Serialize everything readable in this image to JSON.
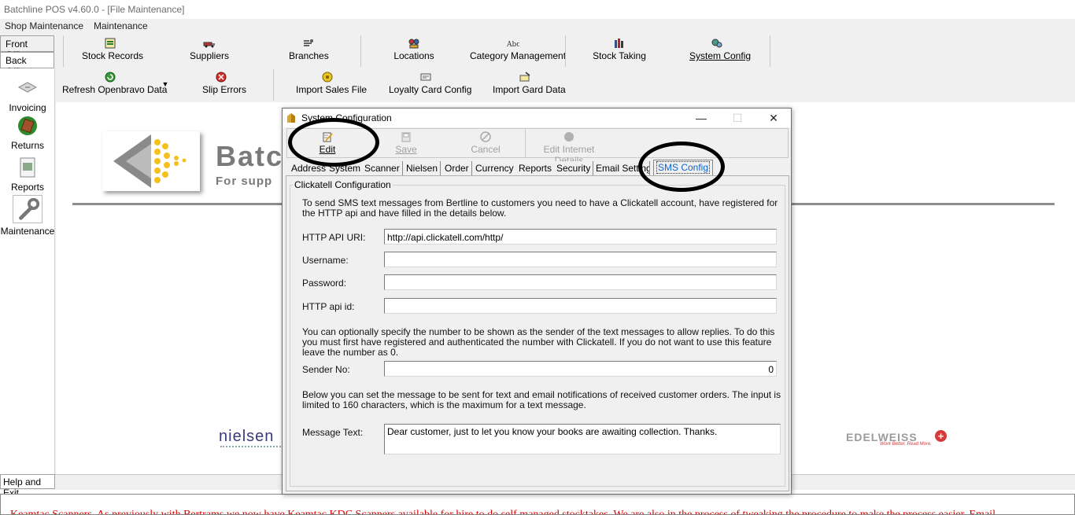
{
  "window": {
    "title": "Batchline POS v4.60.0 - [File Maintenance]"
  },
  "menu": {
    "items": [
      "Shop Maintenance",
      "Maintenance"
    ]
  },
  "office_tabs": {
    "front": "Front Office",
    "back": "Back Office"
  },
  "left_panel": {
    "items": [
      {
        "label": "Invoicing",
        "icon": "invoice-icon"
      },
      {
        "label": "Returns",
        "icon": "returns-icon"
      },
      {
        "label": "Reports",
        "icon": "reports-icon"
      },
      {
        "label": "Maintenance",
        "icon": "wrench-icon"
      }
    ]
  },
  "toolbar_row1": [
    {
      "label": "Stock Records",
      "icon": "stock-records-icon"
    },
    {
      "label": "Suppliers",
      "icon": "truck-icon"
    },
    {
      "label": "Branches",
      "icon": "branches-icon"
    },
    {
      "label": "Locations",
      "icon": "locations-icon"
    },
    {
      "label": "Category Management",
      "icon": "abc-icon"
    },
    {
      "label": "Stock Taking",
      "icon": "books-icon"
    },
    {
      "label": "System Config",
      "icon": "system-config-icon"
    }
  ],
  "toolbar_row2": [
    {
      "label": "Refresh Openbravo Data",
      "icon": "refresh-icon"
    },
    {
      "label": "Slip Errors",
      "icon": "slip-errors-icon"
    },
    {
      "label": "Import Sales File",
      "icon": "import-sales-icon"
    },
    {
      "label": "Loyalty Card Config",
      "icon": "loyalty-card-icon"
    },
    {
      "label": "Import Gard Data",
      "icon": "import-gard-icon"
    }
  ],
  "background": {
    "headline": "Batc",
    "subheadline": "For supp",
    "nielsen": "nielsen",
    "edelweiss": "EDELWEISS",
    "edelweiss_tag": "Work Better, Read More."
  },
  "help": {
    "label": "Help and Exit"
  },
  "news": {
    "text": "Keamtac Scanners. As previously with Bertrams we now have Keamtac KDC Scanners available for hire to do self managed stocktakes. We are also in the process of tweaking the procedure to make the process easier. Email"
  },
  "dialog": {
    "title": "System Configuration",
    "controls": {
      "minimize": "—",
      "maximize": "☐",
      "close": "✕"
    },
    "toolbar": [
      {
        "label": "Edit",
        "icon": "edit-icon",
        "enabled": true
      },
      {
        "label": "Save",
        "icon": "save-icon",
        "enabled": false
      },
      {
        "label": "Cancel",
        "icon": "cancel-icon",
        "enabled": false
      },
      {
        "label": "Edit Internet Details",
        "icon": "internet-icon",
        "enabled": false
      }
    ],
    "tabs": [
      "Address",
      "System",
      "Scanner",
      "Nielsen",
      "Order",
      "Currency",
      "Reports",
      "Security",
      "Email Settings",
      "SMS Config"
    ],
    "selected_tab": "SMS Config",
    "group_title": "Clickatell Configuration",
    "intro": "To send SMS text messages from Bertline to customers you need to have a Clickatell account, have registered for the HTTP api and have filled in the details below.",
    "fields": {
      "http_api_uri": {
        "label": "HTTP API URI:",
        "value": "http://api.clickatell.com/http/"
      },
      "username": {
        "label": "Username:",
        "value": ""
      },
      "password": {
        "label": "Password:",
        "value": ""
      },
      "http_api_id": {
        "label": "HTTP api id:",
        "value": ""
      },
      "sender_no": {
        "label": "Sender No:",
        "value": "0"
      },
      "message_text": {
        "label": "Message Text:",
        "value": "Dear customer, just to let you know your books are awaiting collection. Thanks."
      }
    },
    "sender_note": "You can optionally specify the number to be shown as the sender of the text messages to allow replies. To do this you must first have registered and authenticated the number with Clickatell. If you do not want to use this feature leave the number as 0.",
    "message_note": "Below you can set the message to be sent for text and email notifications of received customer orders. The input is limited to 160 characters, which is the maximum for a text message."
  }
}
